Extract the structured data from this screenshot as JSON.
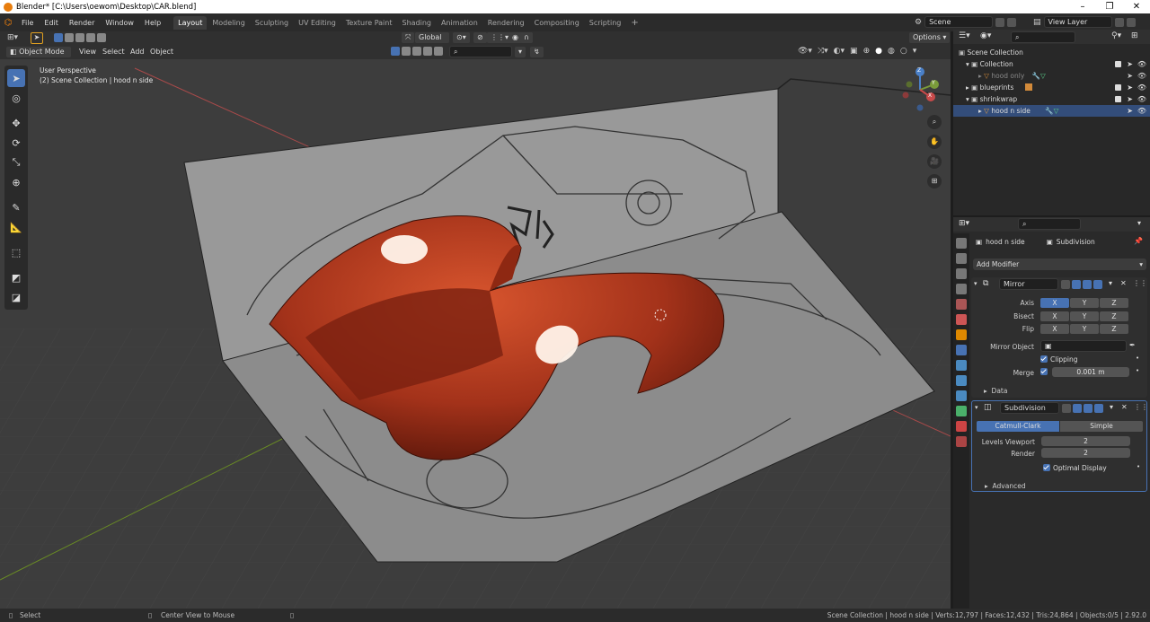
{
  "window": {
    "title": "Blender* [C:\\Users\\oewom\\Desktop\\CAR.blend]"
  },
  "menu": [
    "File",
    "Edit",
    "Render",
    "Window",
    "Help"
  ],
  "workspaces": [
    "Layout",
    "Modeling",
    "Sculpting",
    "UV Editing",
    "Texture Paint",
    "Shading",
    "Animation",
    "Rendering",
    "Compositing",
    "Scripting"
  ],
  "scene_name": "Scene",
  "view_layer": "View Layer",
  "viewport": {
    "mode": "Object Mode",
    "menus": [
      "View",
      "Select",
      "Add",
      "Object"
    ],
    "orientation": "Global",
    "options_label": "Options",
    "overlay_line1": "User Perspective",
    "overlay_line2": "(2) Scene Collection | hood n side",
    "gizmo_labels": {
      "x": "X",
      "y": "Y",
      "z": "Z"
    }
  },
  "outliner": {
    "root": "Scene Collection",
    "rows": [
      {
        "label": "Collection",
        "indent": 1
      },
      {
        "label": "hood only",
        "indent": 2,
        "dim": true
      },
      {
        "label": "blueprints",
        "indent": 1
      },
      {
        "label": "shrinkwrap",
        "indent": 1
      },
      {
        "label": "hood n side",
        "indent": 2
      }
    ]
  },
  "properties": {
    "object_name": "hood n side",
    "modifier_tab": "Subdivision",
    "add_modifier": "Add Modifier",
    "mirror": {
      "name": "Mirror",
      "axis_label": "Axis",
      "bisect_label": "Bisect",
      "flip_label": "Flip",
      "axes": [
        "X",
        "Y",
        "Z"
      ],
      "mirror_object_label": "Mirror Object",
      "clipping_label": "Clipping",
      "merge_label": "Merge",
      "merge_value": "0.001 m",
      "data_label": "Data"
    },
    "subdivision": {
      "name": "Subdivision",
      "catmull": "Catmull-Clark",
      "simple": "Simple",
      "levels_label": "Levels Viewport",
      "levels_value": "2",
      "render_label": "Render",
      "render_value": "2",
      "optimal_label": "Optimal Display",
      "advanced_label": "Advanced"
    }
  },
  "status": {
    "select": "Select",
    "center": "Center View to Mouse",
    "stats": "Scene Collection | hood n side | Verts:12,797 | Faces:12,432 | Tris:24,864 | Objects:0/5 | 2.92.0"
  },
  "colors": {
    "accent": "#4772b3",
    "car": "#b43a1e",
    "blueprint": "#8e8e8e"
  }
}
